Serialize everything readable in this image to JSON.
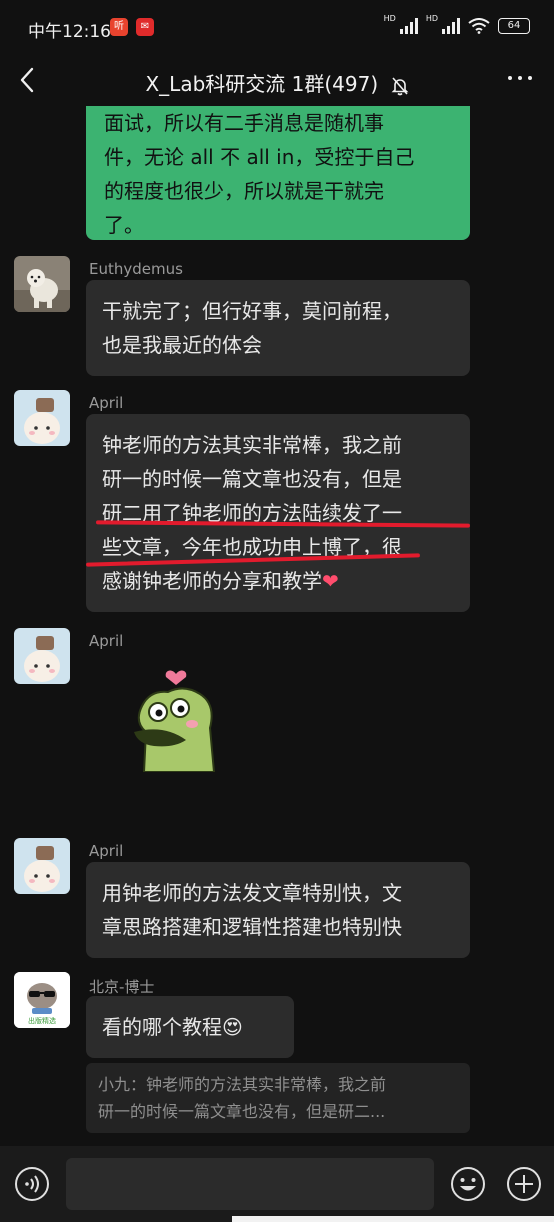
{
  "status_bar": {
    "time": "中午12:16",
    "badges": [
      "听",
      "✉"
    ],
    "battery": "64"
  },
  "header": {
    "title": "X_Lab科研交流 1群(497)",
    "back_icon": "chevron-left-icon",
    "mute_icon": "bell-off-icon",
    "more_icon": "more-dots-icon"
  },
  "messages": {
    "m0": {
      "lines": [
        "面试，所以有二手消息是随机事",
        "件，无论 all 不 all in，受控于自己",
        "的程度也很少，所以就是干就完",
        "了。"
      ]
    },
    "m1": {
      "sender": "Euthydemus",
      "lines": [
        "干就完了；但行好事，莫问前程，",
        "也是我最近的体会"
      ]
    },
    "m2": {
      "sender": "April",
      "lines": [
        "钟老师的方法其实非常棒，我之前",
        "研一的时候一篇文章也没有，但是",
        "研二用了钟老师的方法陆续发了一",
        "些文章，今年也成功申上博了，很",
        "感谢钟老师的分享和教学"
      ],
      "emoji": "❤"
    },
    "m3": {
      "sender": "April",
      "sticker": "green-frog-sticker"
    },
    "m4": {
      "sender": "April",
      "lines": [
        "用钟老师的方法发文章特别快，文",
        "章思路搭建和逻辑性搭建也特别快"
      ]
    },
    "m5": {
      "sender": "北京-博士",
      "text": "看的哪个教程",
      "emoji": "😍",
      "avatar_caption": "出版精选"
    },
    "quote": {
      "lines": [
        "小九：钟老师的方法其实非常棒，我之前",
        "研一的时候一篇文章也没有，但是研二..."
      ]
    }
  },
  "input": {
    "placeholder": ""
  },
  "colors": {
    "background": "#111111",
    "bubble_self": "#3cb371",
    "bubble_other": "#2c2c2c",
    "highlight_line": "#e21b2d"
  }
}
